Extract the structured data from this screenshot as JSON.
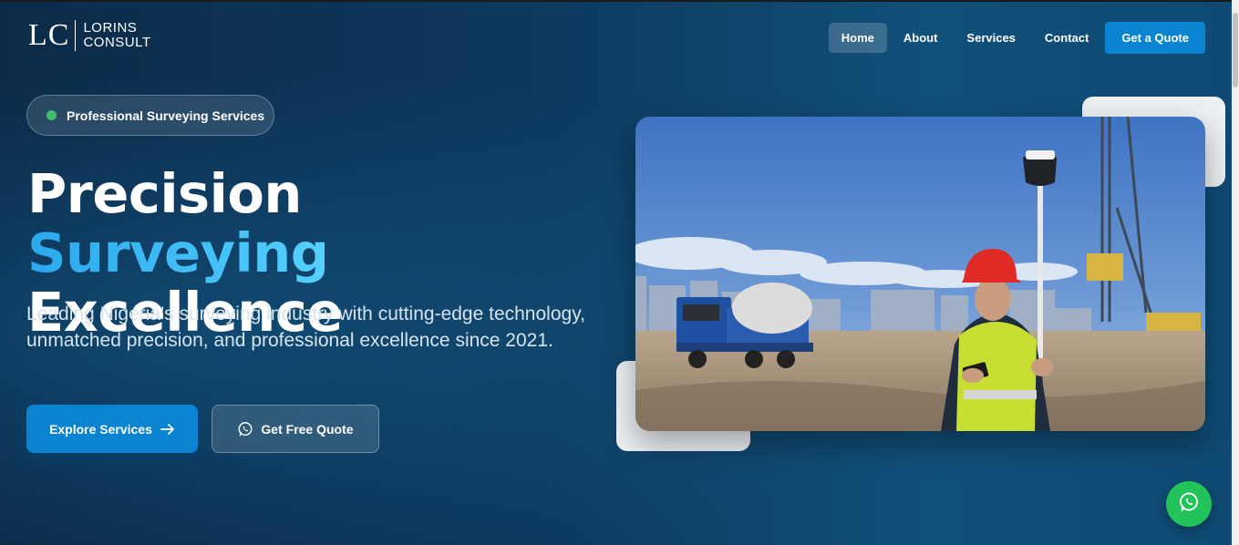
{
  "brand": {
    "mark": "LC",
    "name_line1": "LORINS",
    "name_line2": "CONSULT"
  },
  "nav": {
    "items": [
      {
        "label": "Home",
        "active": true
      },
      {
        "label": "About",
        "active": false
      },
      {
        "label": "Services",
        "active": false
      },
      {
        "label": "Contact",
        "active": false
      }
    ],
    "cta_label": "Get a Quote"
  },
  "hero": {
    "badge": "Professional Surveying Services",
    "headline_part1": "Precision ",
    "headline_accent": "Surveying",
    "headline_part2": "Excellence",
    "subtext": "Leading Nigeria's surveying industry with cutting-edge technology, unmatched precision, and professional excellence since 2021.",
    "primary_button": "Explore Services",
    "secondary_button": "Get Free Quote"
  },
  "icons": {
    "primary_button_icon": "arrow-right-icon",
    "secondary_button_icon": "whatsapp-icon",
    "floating_button_icon": "whatsapp-icon",
    "badge_icon": "status-dot-icon"
  },
  "colors": {
    "accent": "#0a84d0",
    "headline_accent_start": "#2aa8ec",
    "headline_accent_end": "#56d0ff",
    "badge_dot": "#3fbf6a",
    "whatsapp": "#22c35a",
    "background": "#0c2b49"
  }
}
